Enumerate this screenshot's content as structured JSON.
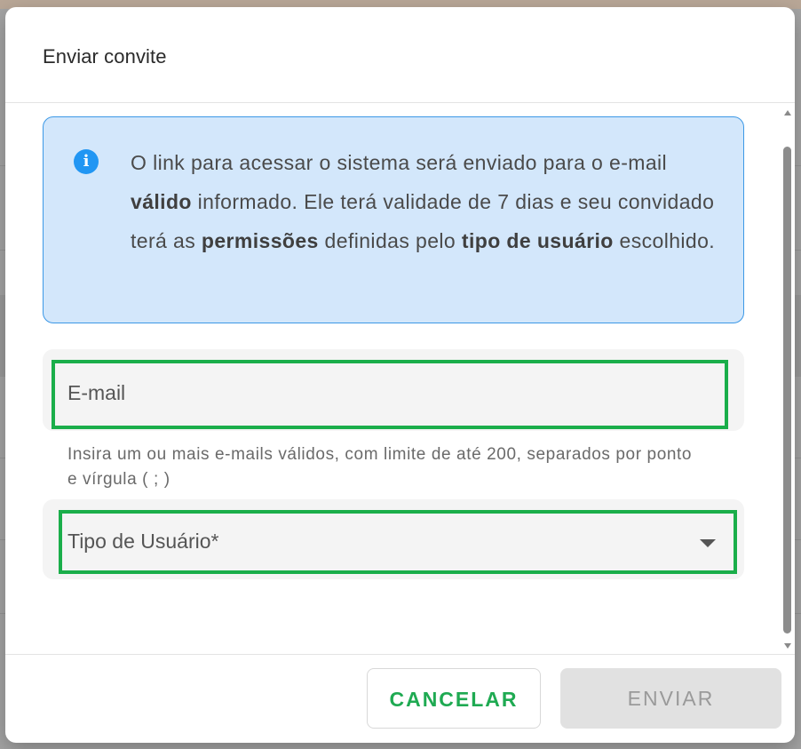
{
  "dialog": {
    "title": "Enviar convite"
  },
  "info": {
    "icon": "info-icon",
    "text_parts": [
      "O link para acessar o sistema será enviado para o e-mail ",
      "válido",
      " informado. Ele terá validade de 7 dias e seu convidado terá as ",
      "permissões",
      " definidas pelo ",
      "tipo de usuário",
      " escolhido."
    ]
  },
  "email_field": {
    "label": "E-mail",
    "value": "",
    "helper": "Insira um ou mais e-mails válidos, com limite de até 200, separados por ponto e vírgula ( ; )"
  },
  "user_type_field": {
    "label": "Tipo de Usuário*",
    "selected": "",
    "icon": "dropdown-arrow-icon"
  },
  "footer": {
    "cancel_label": "CANCELAR",
    "send_label": "ENVIAR"
  },
  "colors": {
    "accent_green": "#1faa52",
    "highlight_green": "#1aae4a",
    "info_bg": "#d3e7fb",
    "info_border": "#3c98e6",
    "info_icon": "#2196f3",
    "disabled_bg": "#e1e1e1"
  }
}
